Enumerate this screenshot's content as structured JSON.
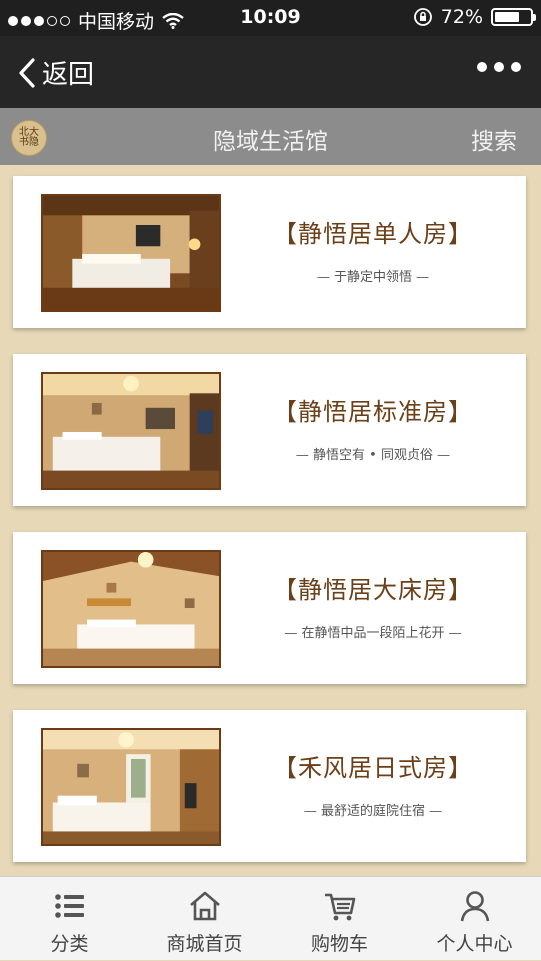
{
  "status_bar": {
    "carrier": "中国移动",
    "time": "10:09",
    "battery": "72%",
    "battery_level": 0.72,
    "signal_bars": 3
  },
  "nav": {
    "back_label": "返回"
  },
  "header": {
    "logo_text": "北大书隐",
    "title": "隐域生活馆",
    "search_label": "搜索"
  },
  "rooms": [
    {
      "name": "【静悟居单人房】",
      "slogan": "— 于静定中领悟 —"
    },
    {
      "name": "【静悟居标准房】",
      "slogan": "— 静悟空有 • 同观贞俗 —"
    },
    {
      "name": "【静悟居大床房】",
      "slogan": "— 在静悟中品一段陌上花开 —"
    },
    {
      "name": "【禾风居日式房】",
      "slogan": "— 最舒适的庭院住宿 —"
    }
  ],
  "tabs": [
    {
      "label": "分类",
      "icon": "list-icon"
    },
    {
      "label": "商城首页",
      "icon": "home-icon"
    },
    {
      "label": "购物车",
      "icon": "cart-icon"
    },
    {
      "label": "个人中心",
      "icon": "user-icon"
    }
  ],
  "colors": {
    "status_bg": "#1f1f1f",
    "nav_bg": "#262626",
    "header_bg": "#8c8c8c",
    "page_bg": "#e7d9b7",
    "room_title": "#6b3f17"
  }
}
